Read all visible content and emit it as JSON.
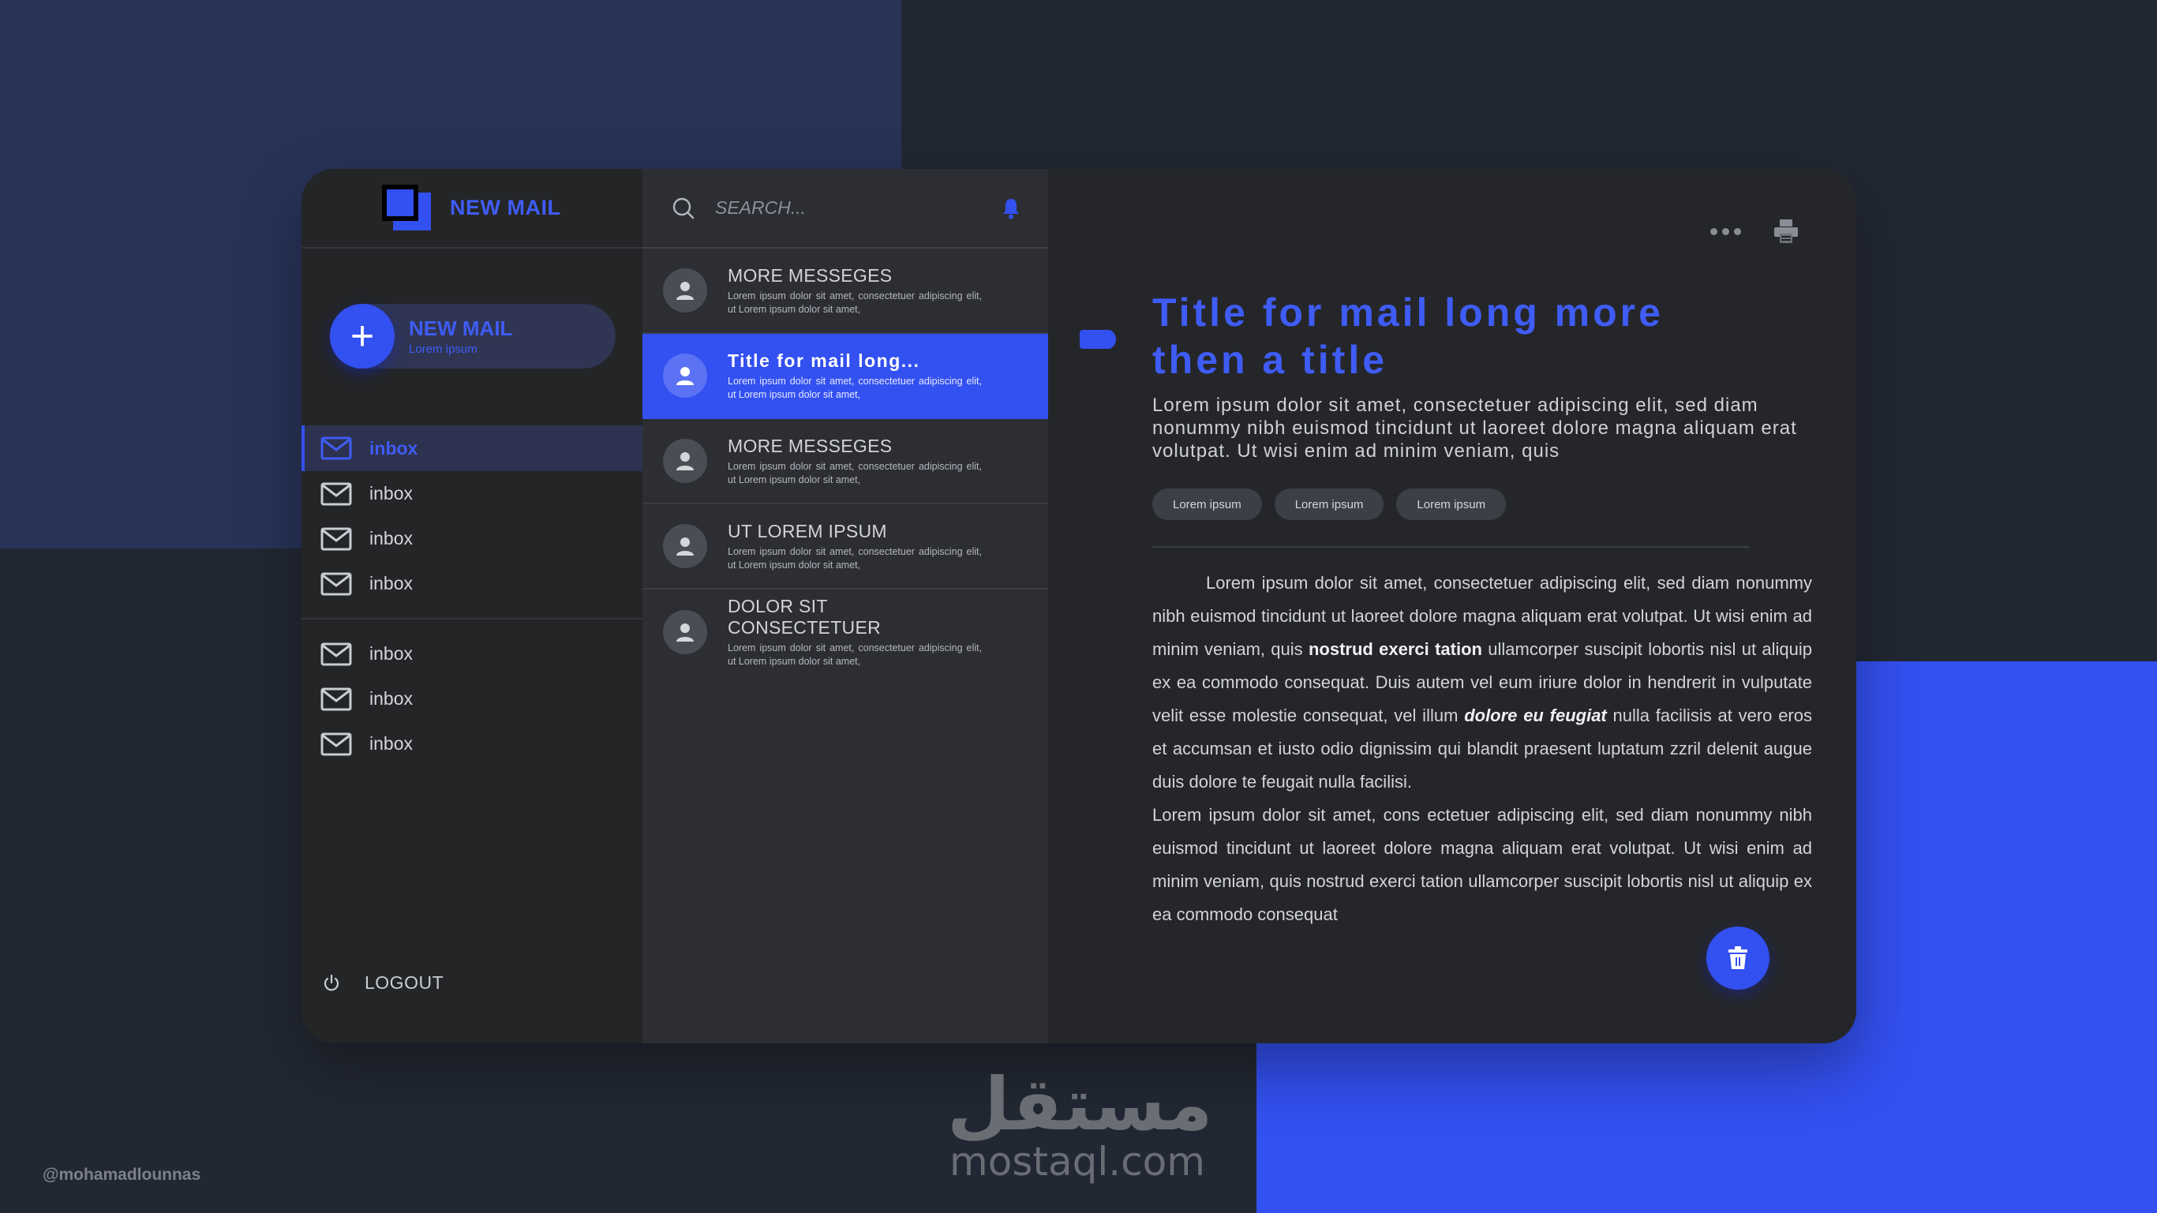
{
  "colors": {
    "accent": "#3350f0",
    "background": "#222833",
    "panel": "#25262a"
  },
  "sidebar": {
    "brand_title": "NEW MAIL",
    "compose": {
      "title": "NEW MAIL",
      "subtitle": "Lorem ipsum"
    },
    "items": [
      {
        "label": "inbox",
        "icon": "envelope-icon",
        "active": true
      },
      {
        "label": "inbox",
        "icon": "envelope-icon",
        "active": false
      },
      {
        "label": "inbox",
        "icon": "envelope-icon",
        "active": false
      },
      {
        "label": "inbox",
        "icon": "envelope-icon",
        "active": false
      },
      {
        "label": "inbox",
        "icon": "envelope-icon",
        "active": false
      },
      {
        "label": "inbox",
        "icon": "envelope-icon",
        "active": false
      },
      {
        "label": "inbox",
        "icon": "envelope-icon",
        "active": false
      }
    ],
    "logout_label": "LOGOUT"
  },
  "search": {
    "placeholder": "SEARCH..."
  },
  "mails": [
    {
      "subject": "MORE MESSEGES",
      "preview": "Lorem ipsum dolor sit amet, consectetuer adipiscing elit, ut Lorem ipsum dolor sit amet,",
      "selected": false
    },
    {
      "subject": "Title for mail long...",
      "preview": "Lorem ipsum dolor sit amet, consectetuer adipiscing elit, ut Lorem ipsum dolor sit amet,",
      "selected": true
    },
    {
      "subject": "MORE MESSEGES",
      "preview": "Lorem ipsum dolor sit amet, consectetuer adipiscing elit, ut Lorem ipsum dolor sit amet,",
      "selected": false
    },
    {
      "subject": "UT LOREM IPSUM",
      "preview": "Lorem ipsum dolor sit amet, consectetuer adipiscing elit, ut Lorem ipsum dolor sit amet,",
      "selected": false
    },
    {
      "subject": "DOLOR SIT CONSECTETUER",
      "preview": "Lorem ipsum dolor sit amet, consectetuer adipiscing elit, ut Lorem ipsum dolor sit amet,",
      "selected": false
    }
  ],
  "reader": {
    "title": "Title for mail long more then a title",
    "summary": "Lorem ipsum dolor sit amet, consectetuer adipiscing elit, sed diam nonummy nibh euismod tincidunt ut laoreet dolore magna aliquam erat volutpat. Ut wisi enim ad minim veniam, quis",
    "tags": [
      "Lorem ipsum",
      "Lorem ipsum",
      "Lorem ipsum"
    ],
    "body": {
      "p1_a": "Lorem ipsum dolor sit amet, consectetuer adipiscing elit, sed diam nonummy nibh euismod tincidunt ut laoreet dolore magna aliquam erat volutpat. Ut wisi enim ad minim veniam, quis ",
      "p1_bold": "nostrud exerci tation",
      "p1_b": " ullamcorper suscipit lobortis nisl ut aliquip ex ea commodo consequat. Duis autem vel eum iriure dolor in hendrerit in vulputate velit esse molestie consequat, vel illum ",
      "p1_bold_italic": "dolore eu feugiat",
      "p1_c": " nulla facilisis at vero eros et accumsan et iusto odio dignissim qui blandit praesent luptatum zzril delenit augue duis dolore te feugait nulla facilisi.",
      "p2": "Lorem ipsum dolor sit amet, cons ectetuer adipiscing elit, sed diam nonummy nibh euismod tincidunt ut laoreet dolore magna aliquam erat volutpat. Ut wisi enim ad minim veniam, quis nostrud exerci tation ullamcorper suscipit lobortis nisl ut aliquip ex ea commodo consequat"
    }
  },
  "watermark": {
    "arabic": "مستقل",
    "latin": "mostaql.com"
  },
  "credit": "@mohamadlounnas"
}
